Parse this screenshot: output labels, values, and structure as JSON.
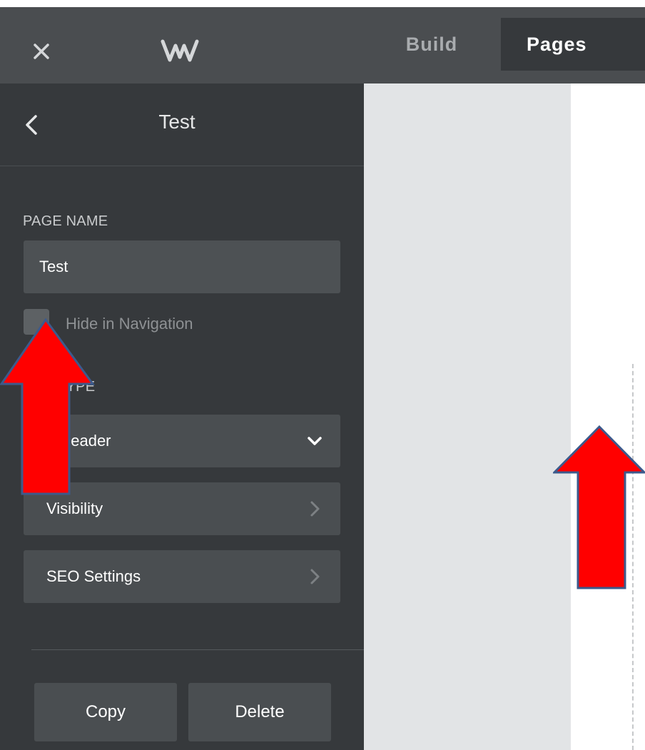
{
  "topbar": {
    "close_icon": "close-icon",
    "logo_icon": "weebly-w-logo",
    "tabs": [
      {
        "label": "Build",
        "active": false
      },
      {
        "label": "Pages",
        "active": true
      }
    ]
  },
  "sidebar": {
    "title": "Test",
    "back_icon": "chevron-left-icon",
    "page_name_label": "PAGE NAME",
    "page_name_value": "Test",
    "hide_in_navigation_label": "Hide in Navigation",
    "hide_in_navigation_checked": false,
    "header_type_label": "HEADER TYPE",
    "header_type_label_visible": "DER TYPE",
    "header_type_value": "No Header",
    "header_type_value_visible": "o Header",
    "visibility_label": "Visibility",
    "seo_settings_label": "SEO Settings",
    "copy_label": "Copy",
    "delete_label": "Delete"
  },
  "colors": {
    "topbar": "#4a4d50",
    "sidebar": "#36393c",
    "row": "#4a4e51",
    "canvas_gray": "#e2e4e6",
    "annotation_arrow_fill": "#ff0000",
    "annotation_arrow_stroke": "#3c5a8c"
  }
}
